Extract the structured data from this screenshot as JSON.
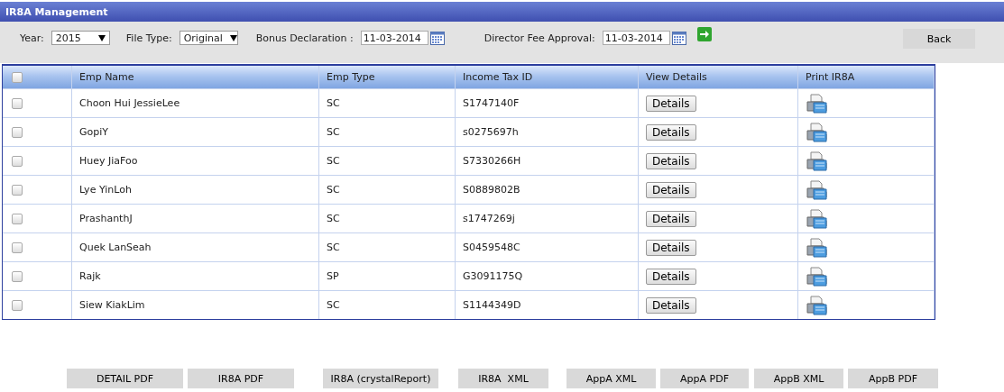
{
  "window": {
    "title": "IR8A Management"
  },
  "filters": [
    {
      "kind": "select",
      "label": "Year:",
      "value": "2015"
    },
    {
      "kind": "select",
      "label": "File Type:",
      "value": "Original"
    },
    {
      "kind": "date",
      "label": "Bonus Declaration :",
      "value": "11-03-2014"
    },
    {
      "kind": "date",
      "label": "Director Fee Approval:",
      "value": "11-03-2014"
    }
  ],
  "back_button": "Back",
  "table": {
    "select_all": {
      "checked": false
    },
    "columns": [
      "Emp Name",
      "Emp Type",
      "Income Tax ID",
      "View Details",
      "Print IR8A"
    ],
    "rows": [
      {
        "checked": false,
        "name": "Choon Hui JessieLee",
        "type": "SC",
        "tax_id": "S1747140F",
        "details": "Details"
      },
      {
        "checked": false,
        "name": "GopiY",
        "type": "SC",
        "tax_id": "s0275697h",
        "details": "Details"
      },
      {
        "checked": false,
        "name": "Huey JiaFoo",
        "type": "SC",
        "tax_id": "S7330266H",
        "details": "Details"
      },
      {
        "checked": false,
        "name": "Lye YinLoh",
        "type": "SC",
        "tax_id": "S0889802B",
        "details": "Details"
      },
      {
        "checked": false,
        "name": "PrashanthJ",
        "type": "SC",
        "tax_id": "s1747269j",
        "details": "Details"
      },
      {
        "checked": false,
        "name": "Quek LanSeah",
        "type": "SC",
        "tax_id": "S0459548C",
        "details": "Details"
      },
      {
        "checked": false,
        "name": "Rajk",
        "type": "SP",
        "tax_id": "G3091175Q",
        "details": "Details"
      },
      {
        "checked": false,
        "name": "Siew KiakLim",
        "type": "SC",
        "tax_id": "S1144349D",
        "details": "Details"
      }
    ]
  },
  "export_buttons": [
    "DETAIL PDF",
    "IR8A PDF",
    "IR8A (crystalReport)",
    "IR8A  XML",
    "AppA XML",
    "AppA PDF",
    "AppB XML",
    "AppB PDF"
  ]
}
